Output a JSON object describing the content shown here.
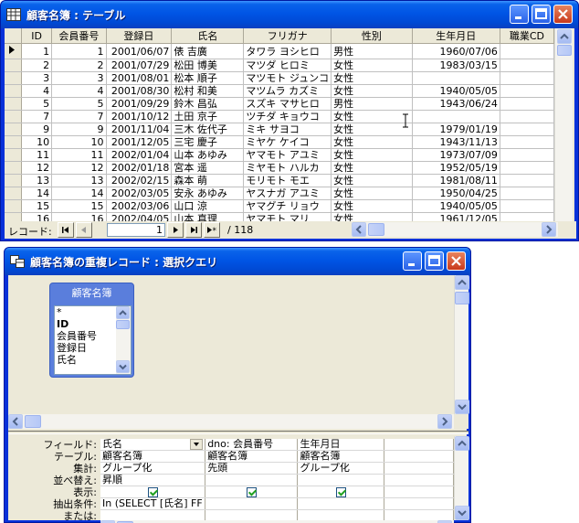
{
  "datasheet_window": {
    "title": "顧客名簿 : テーブル",
    "columns": [
      "ID",
      "会員番号",
      "登録日",
      "氏名",
      "フリガナ",
      "性別",
      "生年月日",
      "職業CD"
    ],
    "rows": [
      [
        "1",
        "1",
        "2001/06/07",
        "俵 吉廣",
        "タワラ ヨシヒロ",
        "男性",
        "1960/07/06",
        ""
      ],
      [
        "2",
        "2",
        "2001/07/29",
        "松田 博美",
        "マツダ ヒロミ",
        "女性",
        "1983/03/15",
        ""
      ],
      [
        "3",
        "3",
        "2001/08/01",
        "松本 順子",
        "マツモト ジュンコ",
        "女性",
        "",
        ""
      ],
      [
        "4",
        "4",
        "2001/08/30",
        "松村 和美",
        "マツムラ カズミ",
        "女性",
        "1940/05/05",
        ""
      ],
      [
        "5",
        "5",
        "2001/09/29",
        "鈴木 昌弘",
        "スズキ マサヒロ",
        "男性",
        "1943/06/24",
        ""
      ],
      [
        "7",
        "7",
        "2001/10/12",
        "土田 京子",
        "ツチダ キョウコ",
        "女性",
        "",
        ""
      ],
      [
        "9",
        "9",
        "2001/11/04",
        "三木 佐代子",
        "ミキ サヨコ",
        "女性",
        "1979/01/19",
        ""
      ],
      [
        "10",
        "10",
        "2001/12/05",
        "三宅 慶子",
        "ミヤケ ケイコ",
        "女性",
        "1943/11/13",
        ""
      ],
      [
        "11",
        "11",
        "2002/01/04",
        "山本 あゆみ",
        "ヤマモト アユミ",
        "女性",
        "1973/07/09",
        ""
      ],
      [
        "12",
        "12",
        "2002/01/18",
        "宮本 遥",
        "ミヤモト ハルカ",
        "女性",
        "1952/05/19",
        ""
      ],
      [
        "13",
        "13",
        "2002/02/15",
        "森本 萌",
        "モリモト モエ",
        "女性",
        "1981/08/11",
        ""
      ],
      [
        "14",
        "14",
        "2002/03/05",
        "安永 あゆみ",
        "ヤスナガ アユミ",
        "女性",
        "1950/04/25",
        ""
      ],
      [
        "15",
        "15",
        "2002/03/06",
        "山口 涼",
        "ヤマグチ リョウ",
        "女性",
        "1940/05/05",
        ""
      ],
      [
        "16",
        "16",
        "2002/04/05",
        "山本 真理",
        "ヤマモト マリ",
        "女性",
        "1961/12/05",
        ""
      ]
    ],
    "nav": {
      "record_label": "レコード:",
      "current": "1",
      "total": "/ 118"
    }
  },
  "query_window": {
    "title": "顧客名簿の重複レコード : 選択クエリ",
    "table_box": {
      "name": "顧客名簿",
      "fields": [
        "*",
        "ID",
        "会員番号",
        "登録日",
        "氏名"
      ]
    },
    "row_labels": [
      "フィールド:",
      "テーブル:",
      "集計:",
      "並べ替え:",
      "表示:",
      "抽出条件:",
      "または:"
    ],
    "grid_columns": [
      {
        "field": "氏名",
        "table": "顧客名簿",
        "total": "グループ化",
        "sort": "昇順",
        "show": true,
        "criteria": "In (SELECT [氏名] FF",
        "or": ""
      },
      {
        "field": "dno: 会員番号",
        "table": "顧客名簿",
        "total": "先頭",
        "sort": "",
        "show": true,
        "criteria": "",
        "or": ""
      },
      {
        "field": "生年月日",
        "table": "顧客名簿",
        "total": "グループ化",
        "sort": "",
        "show": true,
        "criteria": "",
        "or": ""
      },
      {
        "field": "",
        "table": "",
        "total": "",
        "sort": "",
        "show": false,
        "criteria": "",
        "or": ""
      }
    ]
  },
  "colors": {
    "titlebar": "#0055e5",
    "window_face": "#ece9d8",
    "table_box": "#5a7edc"
  }
}
